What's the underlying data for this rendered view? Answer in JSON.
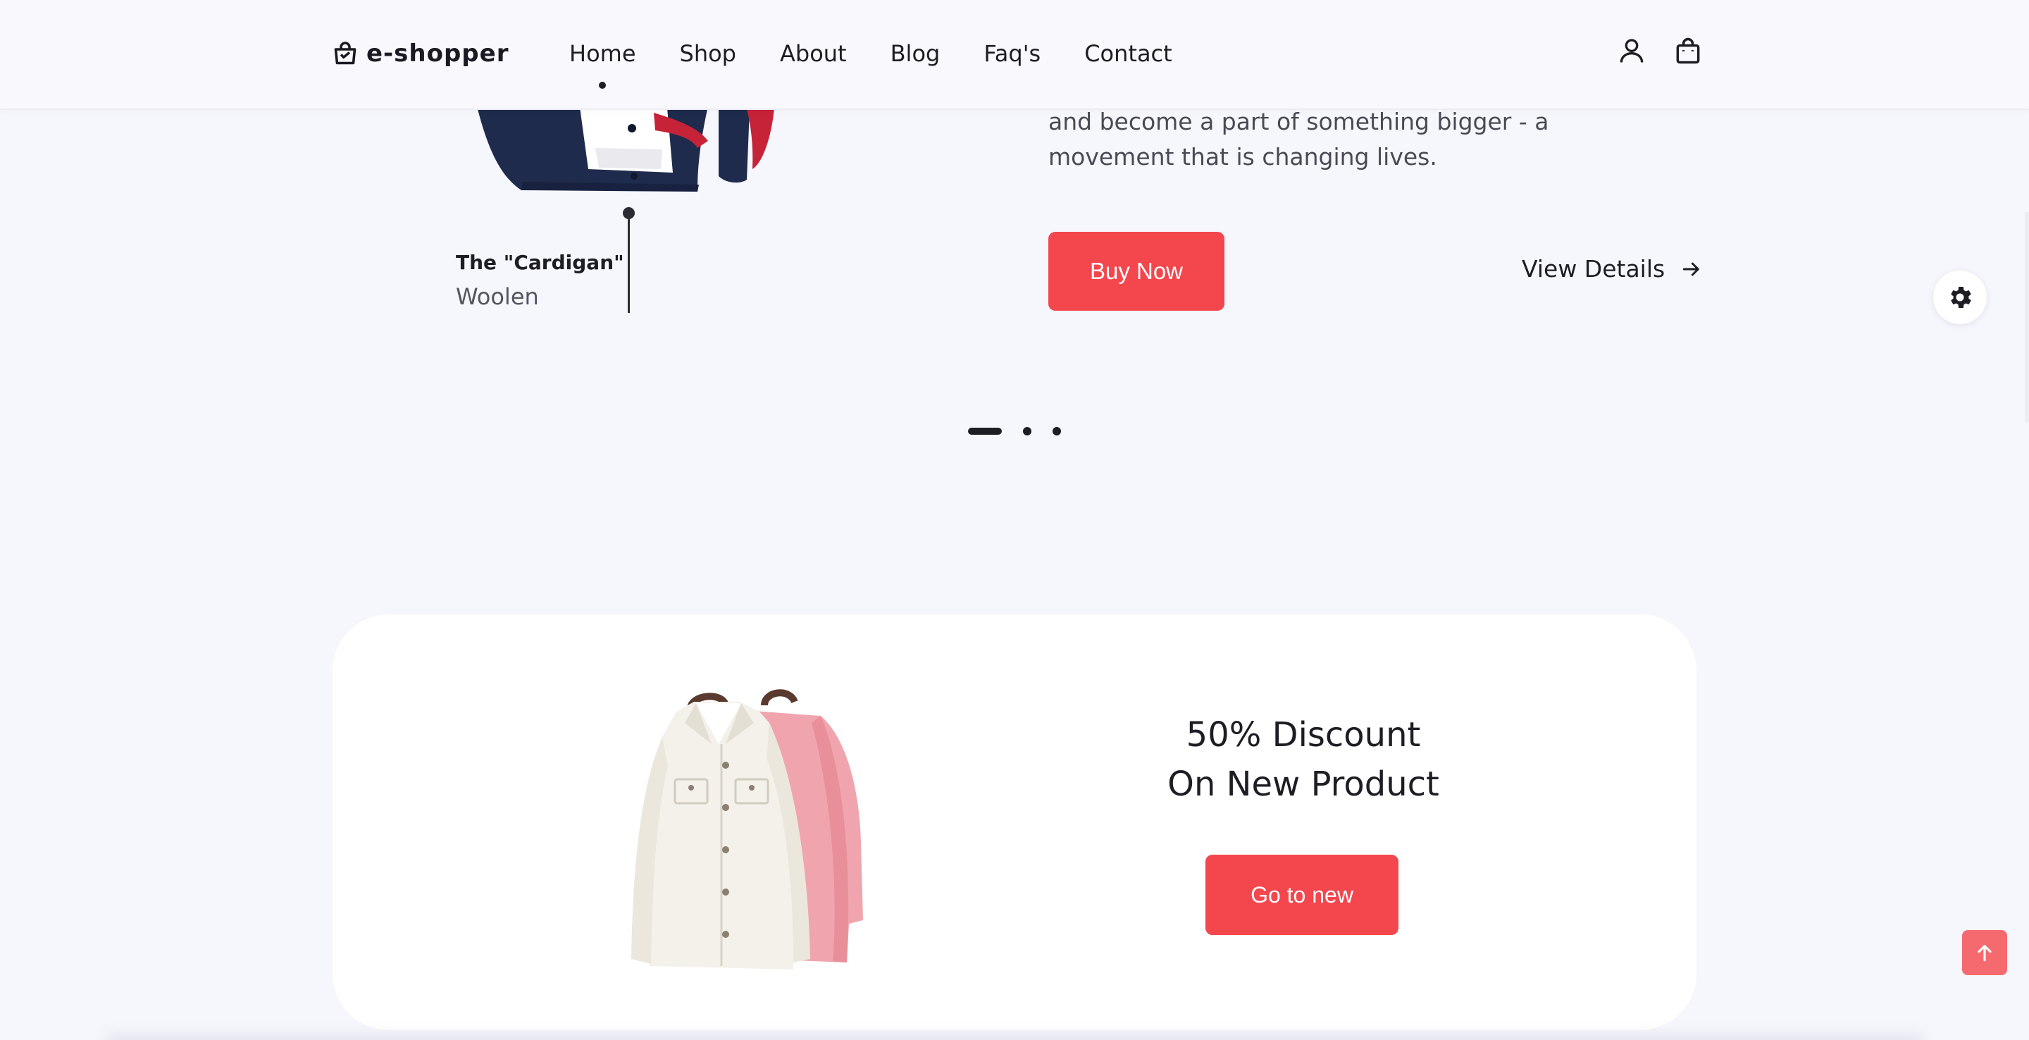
{
  "header": {
    "logo_text": "e-shopper",
    "nav": [
      {
        "label": "Home",
        "active": true
      },
      {
        "label": "Shop"
      },
      {
        "label": "About"
      },
      {
        "label": "Blog"
      },
      {
        "label": "Faq's"
      },
      {
        "label": "Contact"
      }
    ],
    "icons": [
      "user-icon",
      "shopping-bag-icon"
    ]
  },
  "hero": {
    "product_name": "The \"Cardigan\"",
    "product_type": "Woolen",
    "text_line1": "and become a part of something bigger - a",
    "text_line2": "movement that is changing lives.",
    "buy_label": "Buy Now",
    "details_label": "View Details",
    "slides": 3,
    "active_slide": 1
  },
  "promo": {
    "title_line1": "50% Discount",
    "title_line2": "On New Product",
    "button_label": "Go to new"
  },
  "colors": {
    "accent": "#f4464d",
    "background": "#f6f6fd",
    "text": "#1d1d24",
    "back_to_top": "#f46a6e"
  }
}
